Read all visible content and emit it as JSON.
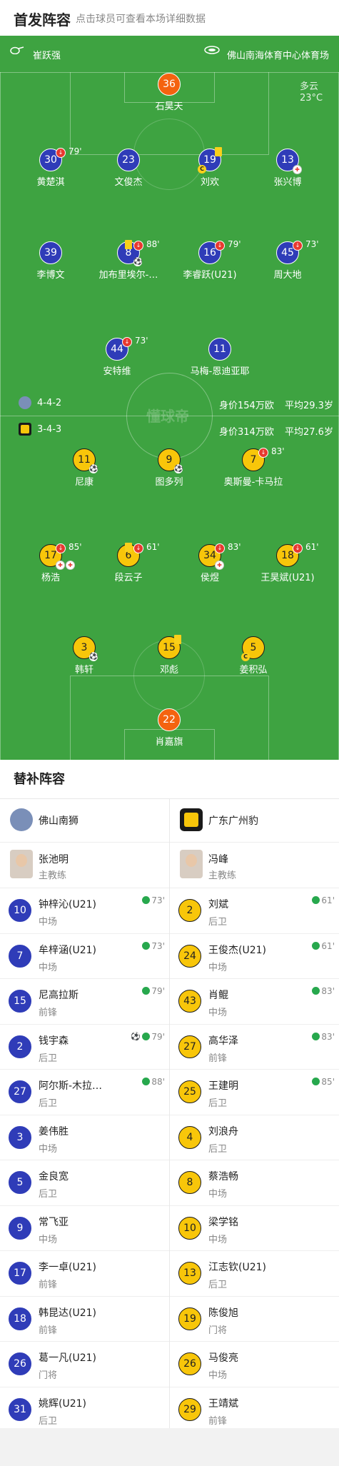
{
  "header": {
    "title": "首发阵容",
    "subtitle": "点击球员可查看本场详细数据"
  },
  "match": {
    "referee": "崔跃强",
    "venue": "佛山南海体育中心体育场",
    "weather": "多云",
    "temperature": "23°C",
    "watermark": "懂球帝"
  },
  "home_team": {
    "name": "佛山南狮",
    "formation": "4-4-2",
    "value": "身价154万欧",
    "age": "平均29.3岁",
    "color": "#2f3cb8"
  },
  "away_team": {
    "name": "广东广州豹",
    "formation": "3-4-3",
    "value": "身价314万欧",
    "age": "平均27.6岁",
    "color": "#f8c60a"
  },
  "home_players": [
    {
      "no": "36",
      "name": "石昊天"
    },
    {
      "no": "30",
      "name": "黄楚淇",
      "sub": "79'"
    },
    {
      "no": "23",
      "name": "文俊杰"
    },
    {
      "no": "19",
      "name": "刘欢"
    },
    {
      "no": "13",
      "name": "张兴博"
    },
    {
      "no": "39",
      "name": "李博文"
    },
    {
      "no": "8",
      "name": "加布里埃尔-…",
      "sub": "88'"
    },
    {
      "no": "16",
      "name": "李睿跃(U21)",
      "sub": "79'"
    },
    {
      "no": "45",
      "name": "周大地",
      "sub": "73'"
    },
    {
      "no": "44",
      "name": "安特维",
      "sub": "73'"
    },
    {
      "no": "11",
      "name": "马梅-恩迪亚耶"
    }
  ],
  "away_players": [
    {
      "no": "11",
      "name": "尼康"
    },
    {
      "no": "9",
      "name": "图多列"
    },
    {
      "no": "7",
      "name": "奥斯曼-卡马拉",
      "sub": "83'"
    },
    {
      "no": "17",
      "name": "杨浩",
      "sub": "85'"
    },
    {
      "no": "6",
      "name": "段云子",
      "sub": "61'"
    },
    {
      "no": "34",
      "name": "侯煜",
      "sub": "83'"
    },
    {
      "no": "18",
      "name": "王昊斌(U21)",
      "sub": "61'"
    },
    {
      "no": "3",
      "name": "韩轩"
    },
    {
      "no": "15",
      "name": "邓彪"
    },
    {
      "no": "5",
      "name": "姜积弘"
    },
    {
      "no": "22",
      "name": "肖嘉旗"
    }
  ],
  "subs": {
    "title": "替补阵容",
    "home": {
      "team": "佛山南狮",
      "coach": "张池明",
      "coach_role": "主教练",
      "players": [
        {
          "no": "10",
          "name": "钟梓沁(U21)",
          "pos": "中场",
          "time": "73'"
        },
        {
          "no": "7",
          "name": "牟梓涵(U21)",
          "pos": "中场",
          "time": "73'"
        },
        {
          "no": "15",
          "name": "尼高拉斯",
          "pos": "前锋",
          "time": "79'"
        },
        {
          "no": "2",
          "name": "钱宇森",
          "pos": "后卫",
          "time": "79'",
          "goal": true
        },
        {
          "no": "27",
          "name": "阿尔斯-木拉…",
          "pos": "后卫",
          "time": "88'"
        },
        {
          "no": "3",
          "name": "姜伟胜",
          "pos": "中场"
        },
        {
          "no": "5",
          "name": "金良宽",
          "pos": "后卫"
        },
        {
          "no": "9",
          "name": "常飞亚",
          "pos": "中场"
        },
        {
          "no": "17",
          "name": "李一卓(U21)",
          "pos": "前锋"
        },
        {
          "no": "18",
          "name": "韩昆达(U21)",
          "pos": "前锋"
        },
        {
          "no": "26",
          "name": "葛一凡(U21)",
          "pos": "门将"
        },
        {
          "no": "31",
          "name": "姚辉(U21)",
          "pos": "后卫"
        }
      ]
    },
    "away": {
      "team": "广东广州豹",
      "coach": "冯峰",
      "coach_role": "主教练",
      "players": [
        {
          "no": "2",
          "name": "刘斌",
          "pos": "后卫",
          "time": "61'"
        },
        {
          "no": "24",
          "name": "王俊杰(U21)",
          "pos": "中场",
          "time": "61'"
        },
        {
          "no": "43",
          "name": "肖鲲",
          "pos": "中场",
          "time": "83'"
        },
        {
          "no": "27",
          "name": "高华泽",
          "pos": "前锋",
          "time": "83'"
        },
        {
          "no": "25",
          "name": "王建明",
          "pos": "后卫",
          "time": "85'"
        },
        {
          "no": "4",
          "name": "刘浪舟",
          "pos": "后卫"
        },
        {
          "no": "8",
          "name": "蔡浩畅",
          "pos": "中场"
        },
        {
          "no": "10",
          "name": "梁学铭",
          "pos": "中场"
        },
        {
          "no": "13",
          "name": "江志钦(U21)",
          "pos": "后卫"
        },
        {
          "no": "19",
          "name": "陈俊旭",
          "pos": "门将"
        },
        {
          "no": "26",
          "name": "马俊亮",
          "pos": "中场"
        },
        {
          "no": "29",
          "name": "王靖斌",
          "pos": "前锋"
        }
      ]
    }
  }
}
